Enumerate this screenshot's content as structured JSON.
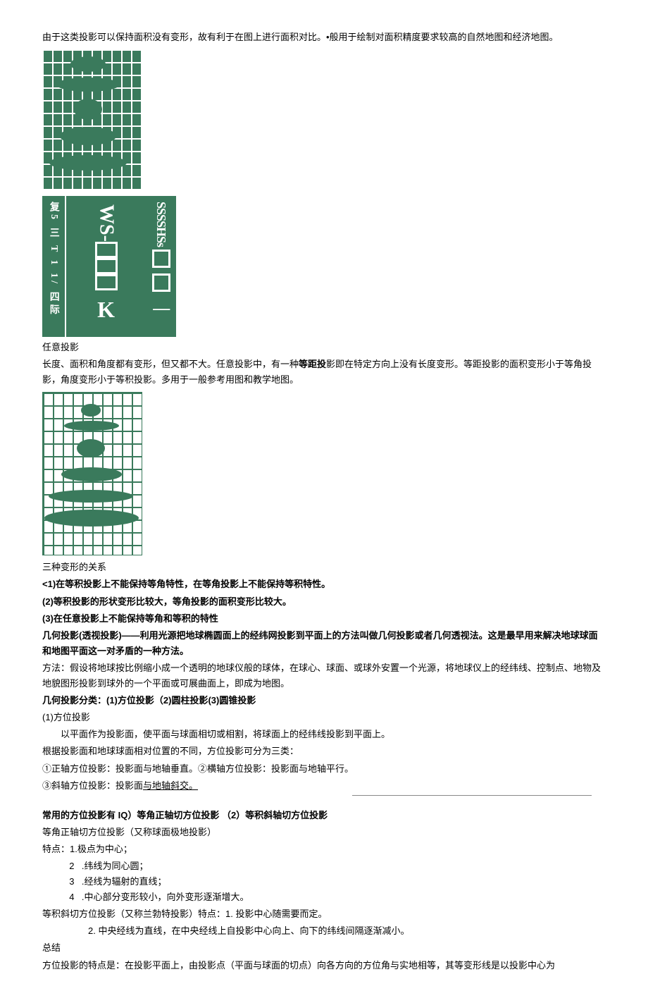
{
  "p1": "由于这类投影可以保持面积没有变形，故有利于在图上进行面积对比。•般用于绘制对面积精度要求较高的自然地图和经济地图。",
  "fig2_side": "复5 三 T 1 1/ 四际",
  "fig2_ws": "WS-",
  "fig2_k": "K",
  "fig2_right": "SSSSHSs",
  "h_arbitrary": "任意投影",
  "p2a": "长度、面积和角度都有变形，但又都不大。任意投影中，有一种",
  "p2b": "等距投",
  "p2c": "影即在特定方向上没有长度变形。等距投影的面积变形小于等角投影，角度变形小于等积投影。多用于一般参考用图和教学地图。",
  "h_relation": "三种变形的关系",
  "rel1": "<1)在等积投影上不能保持等角特性，在等角投影上不能保持等积特性。",
  "rel2": "(2)等积投影的形状变形比较大，等角投影的面积变形比较大。",
  "rel3": "(3)在任意投影上不能保持等角和等积的特性",
  "geo_h": "几何投影(透视投影)——利用光源把地球椭圆面上的经纬网投影到平面上的方法叫做几何投影或者几何透视法。这是最早用来解决地球球面和地图平面这一对矛盾的一种方法。",
  "geo_p": "方法：假设将地球按比例缩小成一个透明的地球仪般的球体，在球心、球面、或球外安置一个光源，将地球仪上的经纬线、控制点、地物及地貌图形投影到球外的一个平面或可展曲面上，即成为地图。",
  "geo_class": "几何投影分类：(1)方位投影（2)圆柱投影(3)圆锥投影",
  "az_h": "(1)方位投影",
  "az_p1": "以平面作为投影面，使平面与球面相切或相割，将球面上的经纬线投影到平面上。",
  "az_p2": "根据投影面和地球球面相对位置的不同，方位投影可分为三类：",
  "az_p3": "①正轴方位投影：投影面与地轴垂直。②横轴方位投影：投影面与地轴平行。",
  "az_p4a": "③斜轴方位投影：投影面",
  "az_p4b": "与地轴斜交。",
  "common_h": "常用的方位投影有 IQ）等角正轴切方位投影 （2）等积斜轴切方位投影",
  "conf_p": "等角正轴切方位投影（又称球面极地投影）",
  "feat_h": "特点：1.极点为中心；",
  "feat2n": "2",
  "feat2": ".纬线为同心圆；",
  "feat3n": "3",
  "feat3": ".经线为辐射的直线；",
  "feat4n": "4",
  "feat4": ".中心部分变形较小，向外变形逐渐增大。",
  "lamb_p": "等积斜切方位投影（又称兰勃特投影）特点：1. 投影中心随需要而定。",
  "lamb_p2": "2. 中央经线为直线，在中央经线上自投影中心向上、向下的纬线间隔逐渐减小。",
  "sum_h": "总结",
  "sum_p": "方位投影的特点是：在投影平面上，由投影点（平面与球面的切点）向各方向的方位角与实地相等，其等变形线是以投影中心为"
}
